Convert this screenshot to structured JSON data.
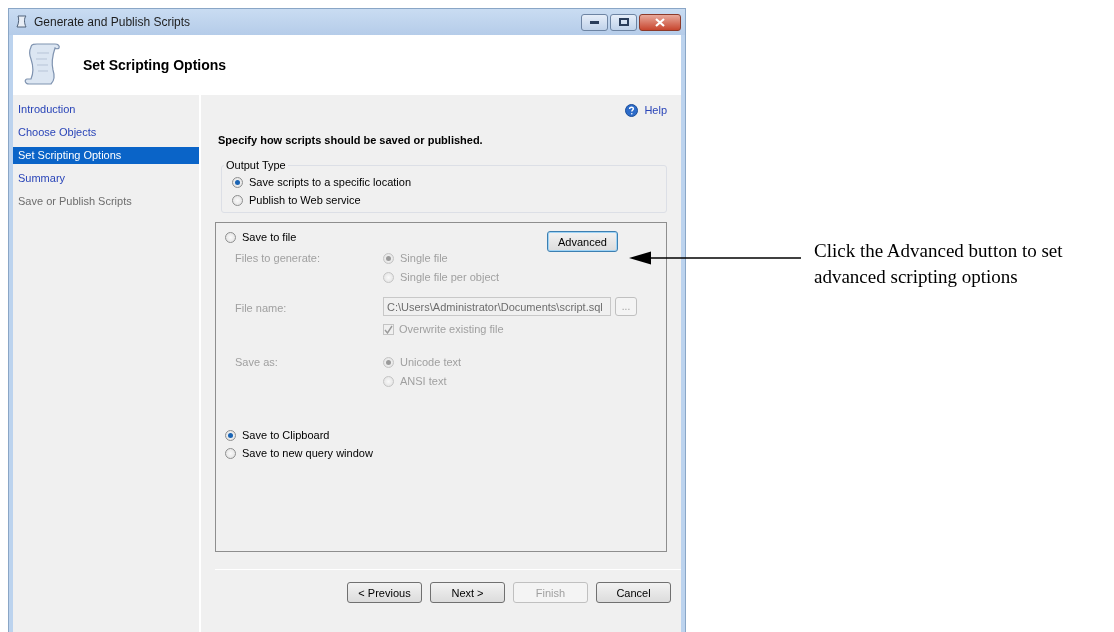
{
  "window": {
    "title": "Generate and Publish Scripts"
  },
  "header": {
    "title": "Set Scripting Options"
  },
  "sidebar": {
    "items": [
      {
        "label": "Introduction",
        "selected": false,
        "disabled": false
      },
      {
        "label": "Choose Objects",
        "selected": false,
        "disabled": false
      },
      {
        "label": "Set Scripting Options",
        "selected": true,
        "disabled": false
      },
      {
        "label": "Summary",
        "selected": false,
        "disabled": false
      },
      {
        "label": "Save or Publish Scripts",
        "selected": false,
        "disabled": true
      }
    ]
  },
  "help": {
    "label": "Help"
  },
  "instruction": "Specify how scripts should be saved or published.",
  "output_type": {
    "legend": "Output Type",
    "options": [
      {
        "label": "Save scripts to a specific location",
        "selected": true
      },
      {
        "label": "Publish to Web service",
        "selected": false
      }
    ]
  },
  "save_panel": {
    "destinations": [
      {
        "label": "Save to file",
        "selected": false
      },
      {
        "label": "Save to Clipboard",
        "selected": true
      },
      {
        "label": "Save to new query window",
        "selected": false
      }
    ],
    "advanced_button": "Advanced",
    "file_settings": {
      "disabled": true,
      "files_to_generate": {
        "label": "Files to generate:",
        "options": [
          {
            "label": "Single file",
            "selected": true
          },
          {
            "label": "Single file per object",
            "selected": false
          }
        ]
      },
      "file_name": {
        "label": "File name:",
        "value": "C:\\Users\\Administrator\\Documents\\script.sql",
        "browse": "..."
      },
      "overwrite": {
        "label": "Overwrite existing file",
        "checked": true
      },
      "save_as": {
        "label": "Save as:",
        "options": [
          {
            "label": "Unicode text",
            "selected": true
          },
          {
            "label": "ANSI text",
            "selected": false
          }
        ]
      }
    }
  },
  "buttons": [
    {
      "label": "< Previous",
      "disabled": false
    },
    {
      "label": "Next >",
      "disabled": false
    },
    {
      "label": "Finish",
      "disabled": true
    },
    {
      "label": "Cancel",
      "disabled": false
    }
  ],
  "callout": "Click the Advanced button to set advanced scripting options"
}
